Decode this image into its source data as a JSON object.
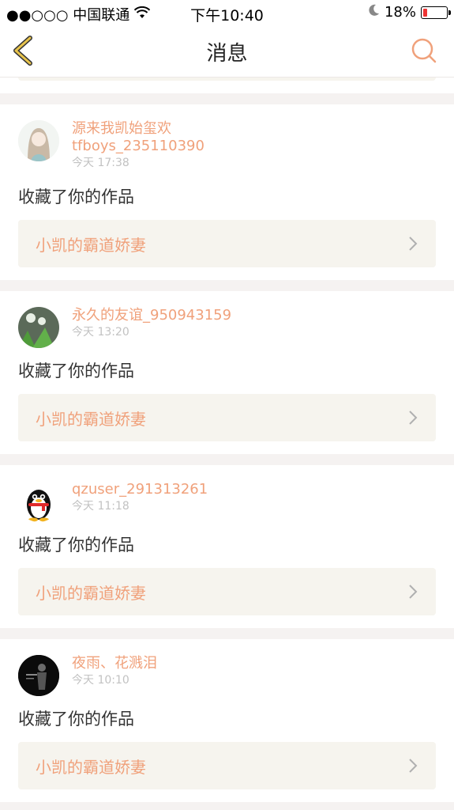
{
  "status_bar": {
    "carrier": "●●○○○ 中国联通",
    "time": "下午10:40",
    "battery": "18%"
  },
  "header": {
    "title": "消息",
    "back_icon": "back-chevron-icon",
    "search_icon": "search-icon"
  },
  "colors": {
    "accent": "#f0a17b",
    "back_icon": "#e7c34c",
    "card_bg": "#ffffff",
    "page_bg": "#f5f2f1",
    "link_bg": "#f6f4ee"
  },
  "notifications": [
    {
      "username": "源来我凯始玺欢\ntfboys_235110390",
      "time": "今天 17:38",
      "action": "收藏了你的作品",
      "work_title": "小凯的霸道娇妻",
      "avatar": "anime-girl-avatar"
    },
    {
      "username": "永久的友谊_950943159",
      "time": "今天 13:20",
      "action": "收藏了你的作品",
      "work_title": "小凯的霸道娇妻",
      "avatar": "dandelion-avatar"
    },
    {
      "username": "qzuser_291313261",
      "time": "今天 11:18",
      "action": "收藏了你的作品",
      "work_title": "小凯的霸道娇妻",
      "avatar": "qq-penguin-avatar"
    },
    {
      "username": "夜雨、花溅泪",
      "time": "今天 10:10",
      "action": "收藏了你的作品",
      "work_title": "小凯的霸道娇妻",
      "avatar": "dark-figure-avatar"
    }
  ]
}
